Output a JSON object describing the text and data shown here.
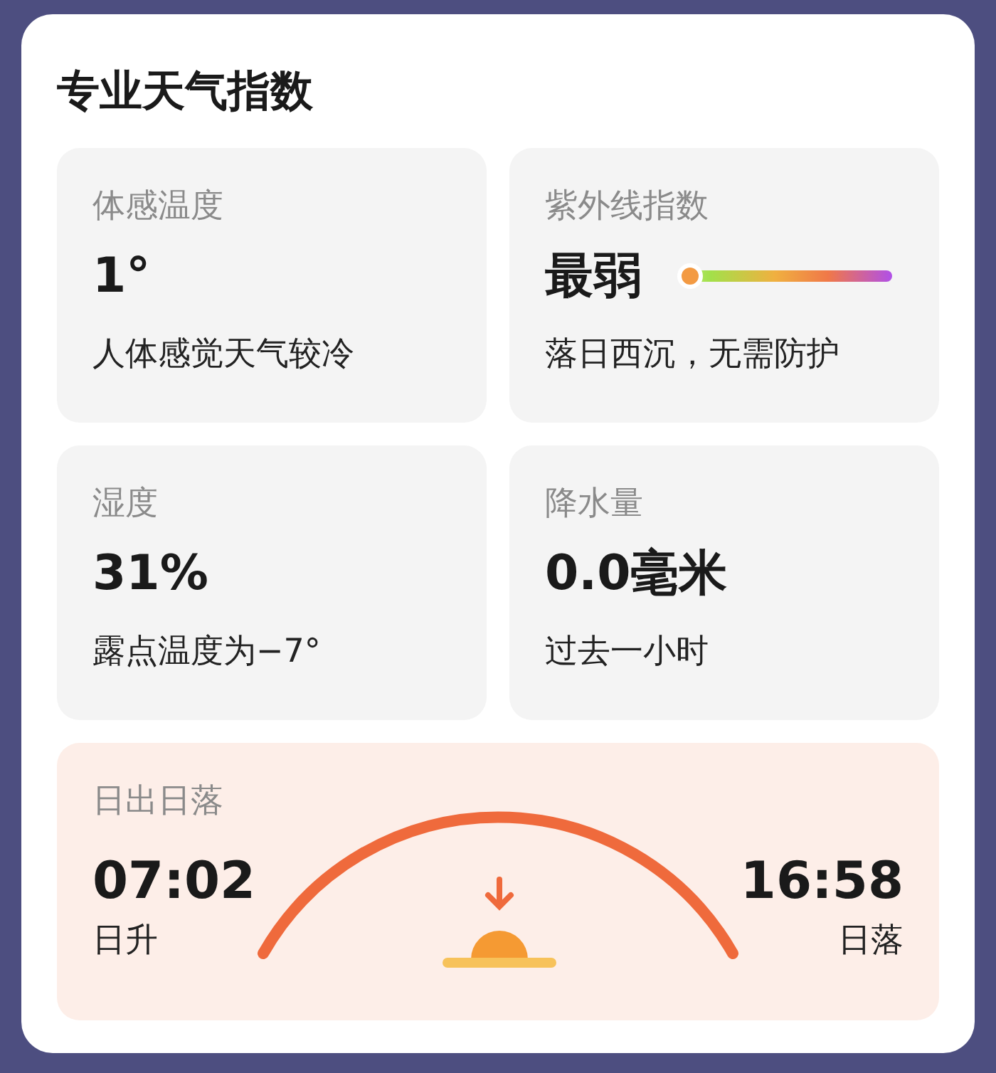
{
  "title": "专业天气指数",
  "cards": [
    {
      "kind": "plain",
      "label": "体感温度",
      "value": "1°",
      "note": "人体感觉天气较冷"
    },
    {
      "kind": "uv",
      "label": "紫外线指数",
      "value": "最弱",
      "level": 0.05,
      "note": "落日西沉，无需防护"
    },
    {
      "kind": "plain",
      "label": "湿度",
      "value": "31%",
      "note": "露点温度为−7°"
    },
    {
      "kind": "plain",
      "label": "降水量",
      "value": "0.0毫米",
      "note": "过去一小时"
    }
  ],
  "sun": {
    "label": "日出日落",
    "sunrise": {
      "time": "07:02",
      "label": "日升"
    },
    "sunset": {
      "time": "16:58",
      "label": "日落"
    }
  }
}
